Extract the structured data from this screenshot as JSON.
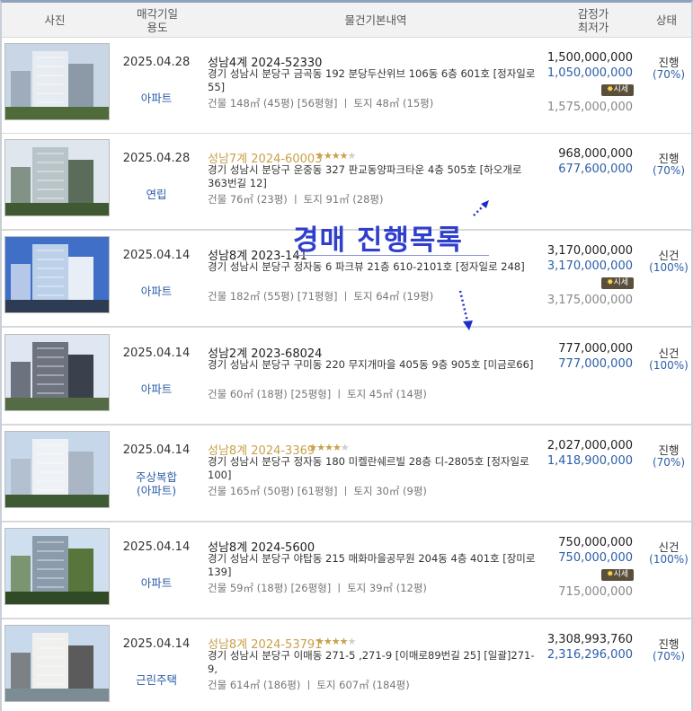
{
  "header": {
    "photo": "사진",
    "date_line1": "매각기일",
    "date_line2": "용도",
    "info": "물건기본내역",
    "price_line1": "감정가",
    "price_line2": "최저가",
    "status": "상태"
  },
  "overlay": {
    "title": "경매 진행목록"
  },
  "market_badge": {
    "icon": "fire",
    "label": "시세"
  },
  "rows": [
    {
      "date": "2025.04.28",
      "use": "아파트",
      "title": "성남4계 2024-52330",
      "highlight": false,
      "stars": 0,
      "address": "경기 성남시 분당구 금곡동 192 분당두산위브 106동 6층 601호 [정자일로 55]",
      "meta": "건물 148㎡ (45평) [56평형]  ㅣ  토지 48㎡ (15평)",
      "appraisal": "1,500,000,000",
      "minimum": "1,050,000,000",
      "market": "1,575,000,000",
      "status": "진행",
      "percent": "(70%)"
    },
    {
      "date": "2025.04.28",
      "use": "연립",
      "title": "성남7계 2024-60003",
      "highlight": true,
      "stars": 4,
      "address": "경기 성남시 분당구 운중동 327 판교동양파크타운 4층 505호 [하오개로363번길 12]",
      "meta": "건물 76㎡ (23평)  ㅣ  토지 91㎡ (28평)",
      "appraisal": "968,000,000",
      "minimum": "677,600,000",
      "market": "",
      "status": "진행",
      "percent": "(70%)"
    },
    {
      "date": "2025.04.14",
      "use": "아파트",
      "title": "성남8계 2023-141",
      "highlight": false,
      "stars": 0,
      "address": "경기 성남시 분당구 정자동 6 파크뷰 21층 610-2101호 [정자일로 248]",
      "meta": "건물 182㎡ (55평) [71평형]  ㅣ  토지 64㎡ (19평)",
      "appraisal": "3,170,000,000",
      "minimum": "3,170,000,000",
      "market": "3,175,000,000",
      "status": "신건",
      "percent": "(100%)"
    },
    {
      "date": "2025.04.14",
      "use": "아파트",
      "title": "성남2계 2023-68024",
      "highlight": false,
      "stars": 0,
      "address": "경기 성남시 분당구 구미동 220 무지개마을 405동 9층 905호 [미금로66]",
      "meta": "건물 60㎡ (18평) [25평형]  ㅣ  토지 45㎡ (14평)",
      "appraisal": "777,000,000",
      "minimum": "777,000,000",
      "market": "",
      "status": "신건",
      "percent": "(100%)"
    },
    {
      "date": "2025.04.14",
      "use": "주상복합",
      "use2": "(아파트)",
      "title": "성남8계 2024-3369",
      "highlight": true,
      "stars": 4,
      "address": "경기 성남시 분당구 정자동 180 미켈란쉐르빌 28층 디-2805호 [정자일로100]",
      "meta": "건물 165㎡ (50평) [61평형]  ㅣ  토지 30㎡ (9평)",
      "appraisal": "2,027,000,000",
      "minimum": "1,418,900,000",
      "market": "",
      "status": "진행",
      "percent": "(70%)"
    },
    {
      "date": "2025.04.14",
      "use": "아파트",
      "title": "성남8계 2024-5600",
      "highlight": false,
      "stars": 0,
      "address": "경기 성남시 분당구 야탑동 215 매화마을공무원 204동 4층 401호 [장미로 139]",
      "meta": "건물 59㎡ (18평) [26평형]  ㅣ  토지 39㎡ (12평)",
      "appraisal": "750,000,000",
      "minimum": "750,000,000",
      "market": "715,000,000",
      "status": "신건",
      "percent": "(100%)"
    },
    {
      "date": "2025.04.14",
      "use": "근린주택",
      "title": "성남8계 2024-53791",
      "highlight": true,
      "stars": 4,
      "address": "경기 성남시 분당구 이매동 271-5 ,271-9 [이매로89번길 25]  [일괄]271-9,",
      "meta": "건물 614㎡ (186평)  ㅣ  토지 607㎡ (184평)",
      "appraisal": "3,308,993,760",
      "minimum": "2,316,296,000",
      "market": "",
      "status": "진행",
      "percent": "(70%)"
    }
  ]
}
